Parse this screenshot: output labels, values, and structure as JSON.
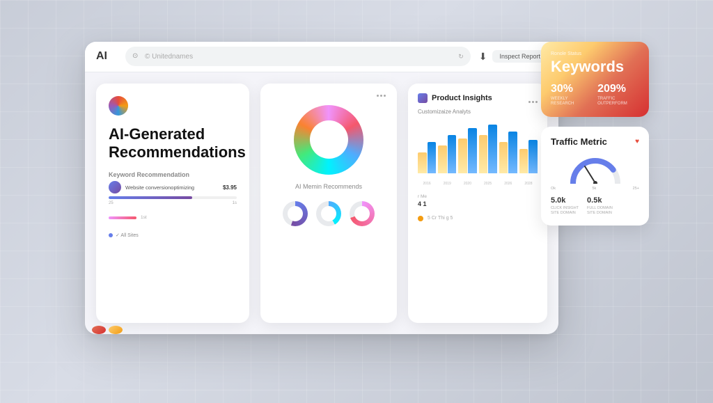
{
  "browser": {
    "logo": "AI",
    "address": "© Unitednames",
    "action_btn": "Inspect Report"
  },
  "card1": {
    "title": "AI-Generated\nRecommendations",
    "section_title": "Keyword Recommendation",
    "keyword_text": "Website conversionoptimizing",
    "keyword_price": "$3.95",
    "progress_values": [
      "25",
      "1s"
    ],
    "small_bar_label": "1st",
    "status_text": "✓ All Sites"
  },
  "card2": {
    "label": "AI Memin Recommends"
  },
  "card3": {
    "title": "Product Insights",
    "subtitle": "Customizaize Analyts",
    "bar_labels": [
      "2016",
      "2019",
      "2020",
      "2025",
      "2026",
      "2028"
    ],
    "stats": [
      {
        "label": "r Me",
        "value": "4 1"
      },
      {
        "label": "5 Cr Thi g 5",
        "value": ""
      }
    ]
  },
  "keywords_card": {
    "header_text": "Ronole Status",
    "title": "Keywords",
    "stat1_value": "30%",
    "stat1_label": "WEEKLY RESEARCH",
    "stat2_value": "209%",
    "stat2_label": "TRAFFIC OUTPERFORM"
  },
  "traffic_card": {
    "title": "Traffic Metric",
    "stat1_value": "5.0k",
    "stat1_label": "CLICK INSIGHT\nSITE DOMAIN",
    "stat2_value": "0.5k",
    "stat2_label": "FULL DOMAIN\nSITE DOMAIN",
    "gauge_labels": {
      "left": "Ok",
      "mid": "5k",
      "right": "25+"
    }
  }
}
